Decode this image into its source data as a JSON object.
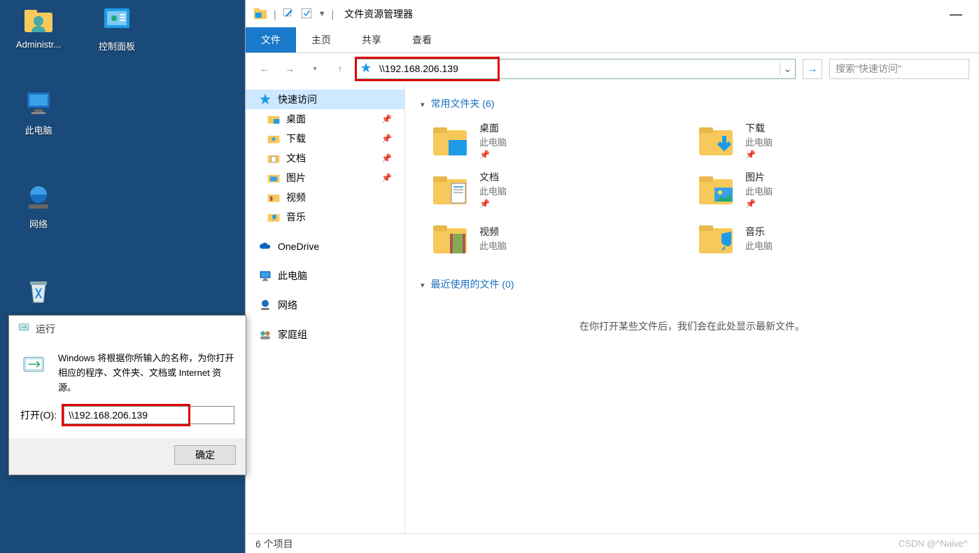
{
  "desktop": {
    "icons": [
      {
        "label": "Administr...",
        "id": "user"
      },
      {
        "label": "控制面板",
        "id": "control-panel"
      },
      {
        "label": "此电脑",
        "id": "this-pc"
      },
      {
        "label": "网络",
        "id": "network"
      },
      {
        "label": "",
        "id": "recycle-bin"
      }
    ]
  },
  "explorer": {
    "window_title": "文件资源管理器",
    "tabs": [
      "文件",
      "主页",
      "共享",
      "查看"
    ],
    "active_tab": 0,
    "address": "\\\\192.168.206.139",
    "search_placeholder": "搜索\"快速访问\"",
    "sidebar": {
      "quick_access": "快速访问",
      "items": [
        {
          "label": "桌面",
          "pin": true
        },
        {
          "label": "下载",
          "pin": true
        },
        {
          "label": "文档",
          "pin": true
        },
        {
          "label": "图片",
          "pin": true
        },
        {
          "label": "视频",
          "pin": false
        },
        {
          "label": "音乐",
          "pin": false
        }
      ],
      "onedrive": "OneDrive",
      "thispc": "此电脑",
      "network": "网络",
      "homegroup": "家庭组"
    },
    "content": {
      "section1": "常用文件夹 (6)",
      "folders": [
        {
          "name": "桌面",
          "loc": "此电脑",
          "pin": true
        },
        {
          "name": "下载",
          "loc": "此电脑",
          "pin": true
        },
        {
          "name": "文档",
          "loc": "此电脑",
          "pin": true
        },
        {
          "name": "图片",
          "loc": "此电脑",
          "pin": true
        },
        {
          "name": "视频",
          "loc": "此电脑",
          "pin": false
        },
        {
          "name": "音乐",
          "loc": "此电脑",
          "pin": false
        }
      ],
      "section2": "最近使用的文件 (0)",
      "empty": "在你打开某些文件后，我们会在此处显示最新文件。"
    },
    "status": "6 个项目"
  },
  "run": {
    "title": "运行",
    "text": "Windows 将根据你所输入的名称，为你打开相应的程序、文件夹、文档或 Internet 资源。",
    "label": "打开(O):",
    "value": "\\\\192.168.206.139",
    "ok": "确定"
  },
  "watermark": "CSDN @^Naive^"
}
